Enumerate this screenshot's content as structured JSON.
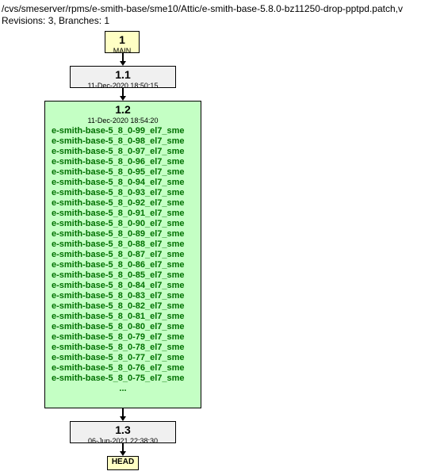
{
  "header": {
    "path": "/cvs/smeserver/rpms/e-smith-base/sme10/Attic/e-smith-base-5.8.0-bz11250-drop-pptpd.patch,v",
    "revisions_label": "Revisions: 3, Branches: 1"
  },
  "graph": {
    "main": {
      "num": "1",
      "label": "MAIN"
    },
    "r11": {
      "num": "1.1",
      "date": "11-Dec-2020 18:50:15"
    },
    "r12": {
      "num": "1.2",
      "date": "11-Dec-2020 18:54:20",
      "tags": [
        "e-smith-base-5_8_0-99_el7_sme",
        "e-smith-base-5_8_0-98_el7_sme",
        "e-smith-base-5_8_0-97_el7_sme",
        "e-smith-base-5_8_0-96_el7_sme",
        "e-smith-base-5_8_0-95_el7_sme",
        "e-smith-base-5_8_0-94_el7_sme",
        "e-smith-base-5_8_0-93_el7_sme",
        "e-smith-base-5_8_0-92_el7_sme",
        "e-smith-base-5_8_0-91_el7_sme",
        "e-smith-base-5_8_0-90_el7_sme",
        "e-smith-base-5_8_0-89_el7_sme",
        "e-smith-base-5_8_0-88_el7_sme",
        "e-smith-base-5_8_0-87_el7_sme",
        "e-smith-base-5_8_0-86_el7_sme",
        "e-smith-base-5_8_0-85_el7_sme",
        "e-smith-base-5_8_0-84_el7_sme",
        "e-smith-base-5_8_0-83_el7_sme",
        "e-smith-base-5_8_0-82_el7_sme",
        "e-smith-base-5_8_0-81_el7_sme",
        "e-smith-base-5_8_0-80_el7_sme",
        "e-smith-base-5_8_0-79_el7_sme",
        "e-smith-base-5_8_0-78_el7_sme",
        "e-smith-base-5_8_0-77_el7_sme",
        "e-smith-base-5_8_0-76_el7_sme",
        "e-smith-base-5_8_0-75_el7_sme"
      ],
      "ellipsis": "..."
    },
    "r13": {
      "num": "1.3",
      "date": "06-Jun-2021 22:38:30"
    },
    "head": {
      "label": "HEAD"
    }
  }
}
